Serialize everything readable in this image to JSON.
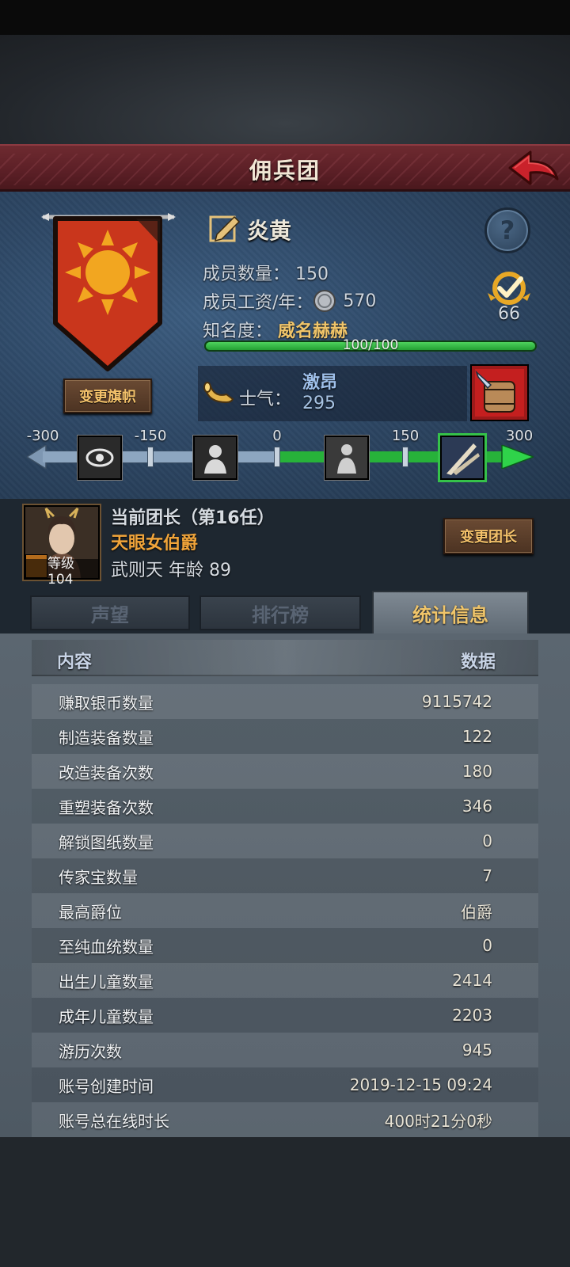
{
  "header": {
    "title": "佣兵团"
  },
  "banner": {
    "change_label": "变更旗帜"
  },
  "company": {
    "name": "炎黄",
    "members_label": "成员数量：",
    "members_value": "150",
    "salary_label": "成员工资/年：",
    "salary_value": "570",
    "fame_label": "知名度：",
    "fame_value": "威名赫赫",
    "fame_progress_text": "100/100",
    "fame_progress": 1.0,
    "award_count": "66"
  },
  "morale": {
    "label": "士气：",
    "state": "激昂",
    "value": "295",
    "scale": [
      "-300",
      "-150",
      "0",
      "150",
      "300"
    ],
    "current": 295
  },
  "leader": {
    "title": "当前团长（第16任）",
    "rank": "天眼女伯爵",
    "name_age": "武则天  年龄 89",
    "level": "等级104",
    "change_label": "变更团长"
  },
  "tabs": [
    {
      "label": "声望"
    },
    {
      "label": "排行榜"
    },
    {
      "label": "统计信息"
    }
  ],
  "stats": {
    "head_left": "内容",
    "head_right": "数据",
    "rows": [
      {
        "k": "赚取银币数量",
        "v": "9115742"
      },
      {
        "k": "制造装备数量",
        "v": "122"
      },
      {
        "k": "改造装备次数",
        "v": "180"
      },
      {
        "k": "重塑装备次数",
        "v": "346"
      },
      {
        "k": "解锁图纸数量",
        "v": "0"
      },
      {
        "k": "传家宝数量",
        "v": "7"
      },
      {
        "k": "最高爵位",
        "v": "伯爵"
      },
      {
        "k": "至纯血统数量",
        "v": "0"
      },
      {
        "k": "出生儿童数量",
        "v": "2414"
      },
      {
        "k": "成年儿童数量",
        "v": "2203"
      },
      {
        "k": "游历次数",
        "v": "945"
      },
      {
        "k": "账号创建时间",
        "v": "2019-12-15 09:24"
      },
      {
        "k": "账号总在线时长",
        "v": "400时21分0秒"
      }
    ]
  }
}
